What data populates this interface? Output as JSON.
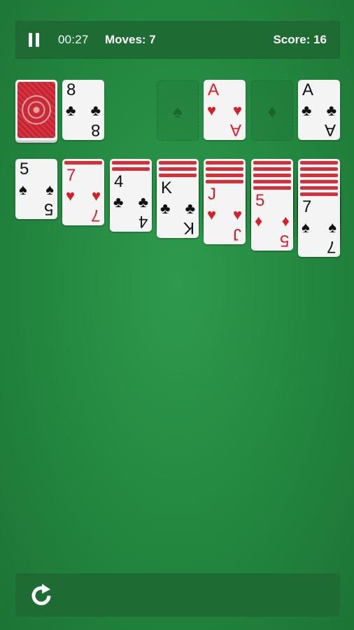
{
  "header": {
    "time": "00:27",
    "moves_label": "Moves: 7",
    "score_label": "Score: 16"
  },
  "waste": {
    "rank": "8",
    "suit": "♣",
    "color": "black"
  },
  "foundations": [
    {
      "empty": true,
      "suit": "♠"
    },
    {
      "empty": false,
      "rank": "A",
      "suit": "♥",
      "color": "red"
    },
    {
      "empty": true,
      "suit": "♦"
    },
    {
      "empty": false,
      "rank": "A",
      "suit": "♣",
      "color": "black"
    }
  ],
  "tableau": [
    {
      "hidden": 0,
      "rank": "5",
      "suit": "♠",
      "color": "black"
    },
    {
      "hidden": 1,
      "rank": "7",
      "suit": "♥",
      "color": "red"
    },
    {
      "hidden": 2,
      "rank": "4",
      "suit": "♣",
      "color": "black"
    },
    {
      "hidden": 3,
      "rank": "K",
      "suit": "♣",
      "color": "black"
    },
    {
      "hidden": 4,
      "rank": "J",
      "suit": "♥",
      "color": "red"
    },
    {
      "hidden": 5,
      "rank": "5",
      "suit": "♦",
      "color": "red"
    },
    {
      "hidden": 6,
      "rank": "7",
      "suit": "♠",
      "color": "black"
    }
  ],
  "colors": {
    "felt": "#23863f",
    "bar": "#1f6b34",
    "card_red": "#d71f2a",
    "card_back": "#d53440"
  },
  "icons": {
    "pause": "pause-icon",
    "undo": "undo-icon"
  }
}
